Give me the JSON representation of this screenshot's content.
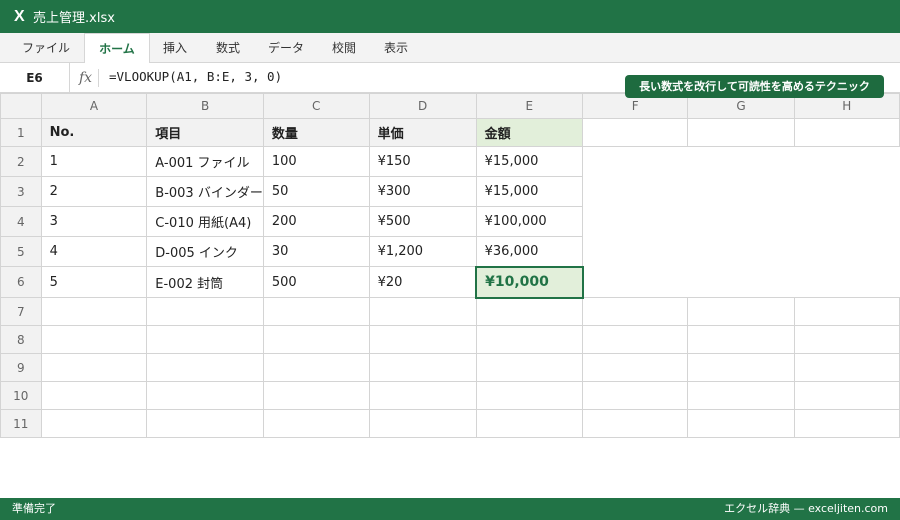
{
  "titlebar": {
    "app_icon": "X",
    "title": "売上管理.xlsx"
  },
  "ribbon": {
    "tabs": [
      {
        "label": "ファイル"
      },
      {
        "label": "ホーム"
      },
      {
        "label": "挿入"
      },
      {
        "label": "数式"
      },
      {
        "label": "データ"
      },
      {
        "label": "校閲"
      },
      {
        "label": "表示"
      }
    ],
    "active_tab": "ホーム"
  },
  "formula_bar": {
    "name_box": "E6",
    "fx_label": "fx",
    "formula": "=VLOOKUP(A1, B:E, 3, 0)"
  },
  "tip_badge": "長い数式を改行して可読性を高めるテクニック",
  "sheet": {
    "columns": [
      "A",
      "B",
      "C",
      "D",
      "E",
      "F",
      "G",
      "H"
    ],
    "row_numbers": [
      "1",
      "2",
      "3",
      "4",
      "5",
      "6",
      "7",
      "8",
      "9",
      "10",
      "11"
    ],
    "header": [
      "No.",
      "項目",
      "数量",
      "単価",
      "金額"
    ],
    "rows": [
      [
        "1",
        "A-001 ファイル",
        "100",
        "¥150",
        "¥15,000"
      ],
      [
        "2",
        "B-003 バインダー",
        "50",
        "¥300",
        "¥15,000"
      ],
      [
        "3",
        "C-010 用紙(A4)",
        "200",
        "¥500",
        "¥100,000"
      ],
      [
        "4",
        "D-005 インク",
        "30",
        "¥1,200",
        "¥36,000"
      ],
      [
        "5",
        "E-002 封筒",
        "500",
        "¥20",
        "¥10,000"
      ]
    ],
    "selected_cell": "E6"
  },
  "statusbar": {
    "left": "準備完了",
    "right": "エクセル辞典 — exceljiten.com"
  },
  "colors": {
    "accent": "#217346",
    "selected_fill": "#e2efda",
    "header_fill": "#f2f2f2"
  },
  "icons": {
    "app": "excel-icon",
    "fx": "function-icon"
  }
}
